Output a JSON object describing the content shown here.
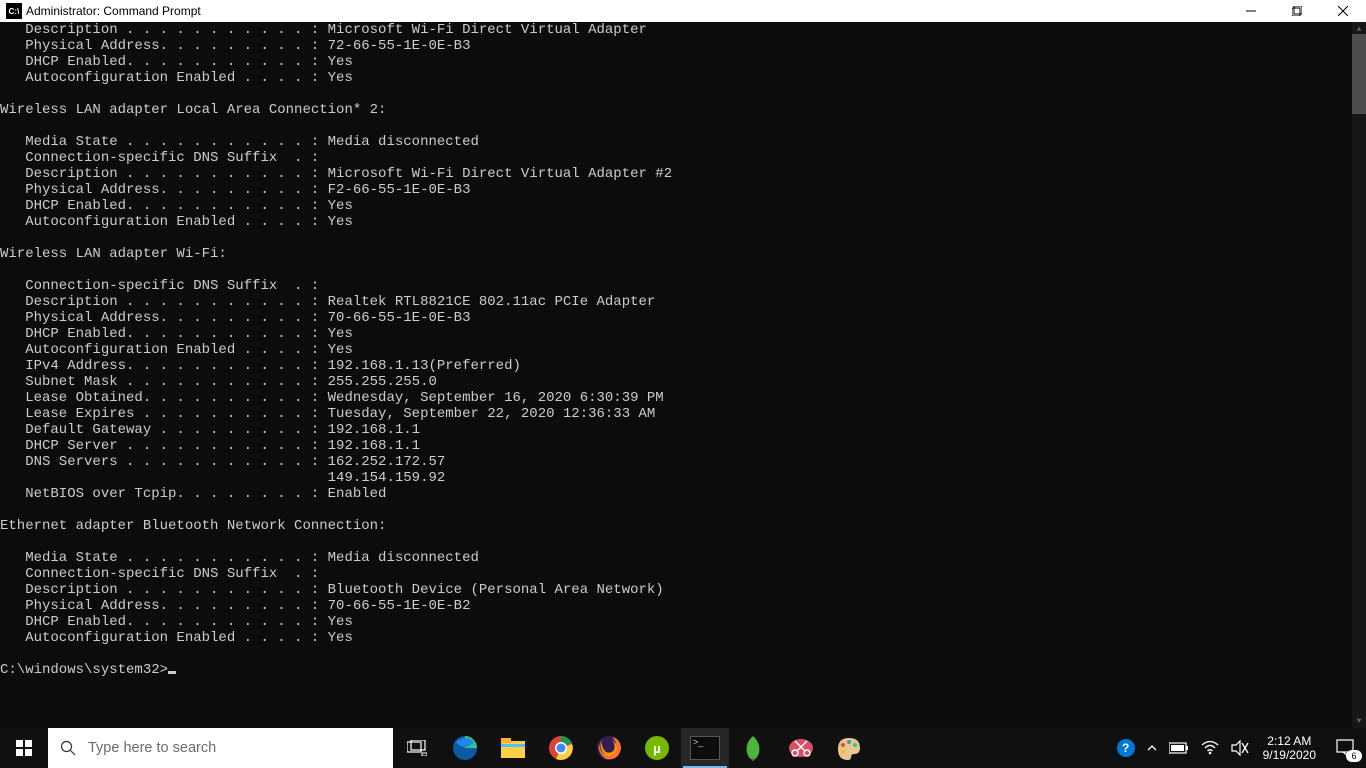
{
  "window": {
    "title": "Administrator: Command Prompt",
    "icon_label": "C:\\"
  },
  "console": {
    "lines": [
      "   Description . . . . . . . . . . . : Microsoft Wi-Fi Direct Virtual Adapter",
      "   Physical Address. . . . . . . . . : 72-66-55-1E-0E-B3",
      "   DHCP Enabled. . . . . . . . . . . : Yes",
      "   Autoconfiguration Enabled . . . . : Yes",
      "",
      "Wireless LAN adapter Local Area Connection* 2:",
      "",
      "   Media State . . . . . . . . . . . : Media disconnected",
      "   Connection-specific DNS Suffix  . :",
      "   Description . . . . . . . . . . . : Microsoft Wi-Fi Direct Virtual Adapter #2",
      "   Physical Address. . . . . . . . . : F2-66-55-1E-0E-B3",
      "   DHCP Enabled. . . . . . . . . . . : Yes",
      "   Autoconfiguration Enabled . . . . : Yes",
      "",
      "Wireless LAN adapter Wi-Fi:",
      "",
      "   Connection-specific DNS Suffix  . :",
      "   Description . . . . . . . . . . . : Realtek RTL8821CE 802.11ac PCIe Adapter",
      "   Physical Address. . . . . . . . . : 70-66-55-1E-0E-B3",
      "   DHCP Enabled. . . . . . . . . . . : Yes",
      "   Autoconfiguration Enabled . . . . : Yes",
      "   IPv4 Address. . . . . . . . . . . : 192.168.1.13(Preferred)",
      "   Subnet Mask . . . . . . . . . . . : 255.255.255.0",
      "   Lease Obtained. . . . . . . . . . : Wednesday, September 16, 2020 6:30:39 PM",
      "   Lease Expires . . . . . . . . . . : Tuesday, September 22, 2020 12:36:33 AM",
      "   Default Gateway . . . . . . . . . : 192.168.1.1",
      "   DHCP Server . . . . . . . . . . . : 192.168.1.1",
      "   DNS Servers . . . . . . . . . . . : 162.252.172.57",
      "                                       149.154.159.92",
      "   NetBIOS over Tcpip. . . . . . . . : Enabled",
      "",
      "Ethernet adapter Bluetooth Network Connection:",
      "",
      "   Media State . . . . . . . . . . . : Media disconnected",
      "   Connection-specific DNS Suffix  . :",
      "   Description . . . . . . . . . . . : Bluetooth Device (Personal Area Network)",
      "   Physical Address. . . . . . . . . : 70-66-55-1E-0E-B2",
      "   DHCP Enabled. . . . . . . . . . . : Yes",
      "   Autoconfiguration Enabled . . . . : Yes",
      ""
    ],
    "prompt": "C:\\windows\\system32>"
  },
  "taskbar": {
    "search_placeholder": "Type here to search",
    "clock_time": "2:12 AM",
    "clock_date": "9/19/2020",
    "notif_count": "6"
  }
}
